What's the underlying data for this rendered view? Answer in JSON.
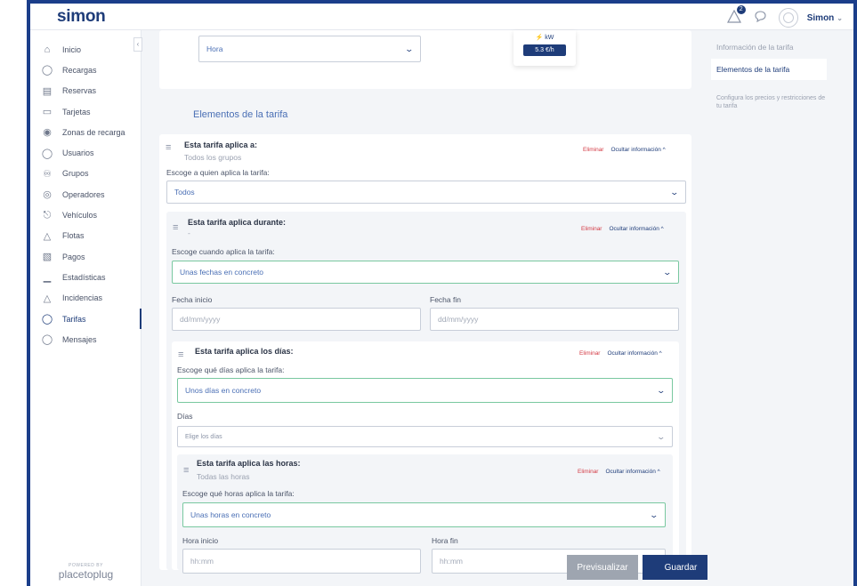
{
  "app": {
    "logo": "simon"
  },
  "topbar": {
    "notifications_count": "2",
    "user_name": "Simon"
  },
  "sidebar": {
    "items": [
      {
        "label": "Inicio",
        "icon": "home-icon"
      },
      {
        "label": "Recargas",
        "icon": "charge-icon"
      },
      {
        "label": "Reservas",
        "icon": "calendar-icon"
      },
      {
        "label": "Tarjetas",
        "icon": "card-icon"
      },
      {
        "label": "Zonas de recarga",
        "icon": "location-icon"
      },
      {
        "label": "Usuarios",
        "icon": "user-icon"
      },
      {
        "label": "Grupos",
        "icon": "group-icon"
      },
      {
        "label": "Operadores",
        "icon": "operator-icon"
      },
      {
        "label": "Vehículos",
        "icon": "car-icon"
      },
      {
        "label": "Flotas",
        "icon": "fleet-icon"
      },
      {
        "label": "Pagos",
        "icon": "payment-icon"
      },
      {
        "label": "Estadísticas",
        "icon": "stats-icon"
      },
      {
        "label": "Incidencias",
        "icon": "alert-icon"
      },
      {
        "label": "Tarifas",
        "icon": "tag-icon",
        "active": true
      },
      {
        "label": "Mensajes",
        "icon": "chat-icon"
      }
    ],
    "powered_by": "POWERED BY",
    "powered_brand": "placetoplug"
  },
  "top_card": {
    "hora_select_value": "Hora",
    "kw_label": "⚡ kW",
    "price": "5.3 €/h"
  },
  "section_title": "Elementos de la tarifa",
  "groups_block": {
    "title": "Esta tarifa aplica a:",
    "subtitle": "Todos los grupos",
    "delete_label": "Eliminar",
    "hide_label": "Ocultar información ^",
    "select_label": "Escoge a quien aplica la tarifa:",
    "select_value": "Todos"
  },
  "dates_block": {
    "title": "Esta tarifa aplica durante:",
    "subtitle": "-",
    "delete_label": "Eliminar",
    "hide_label": "Ocultar información ^",
    "select_label": "Escoge cuando aplica la tarifa:",
    "select_value": "Unas fechas en concreto",
    "start_label": "Fecha inicio",
    "start_placeholder": "dd/mm/yyyy",
    "end_label": "Fecha fin",
    "end_placeholder": "dd/mm/yyyy"
  },
  "days_block": {
    "title": "Esta tarifa aplica los días:",
    "delete_label": "Eliminar",
    "hide_label": "Ocultar información ^",
    "select_label": "Escoge qué días aplica la tarifa:",
    "select_value": "Unos días en concreto",
    "days_label": "Días",
    "days_placeholder": "Elige los días"
  },
  "hours_block": {
    "title": "Esta tarifa aplica las horas:",
    "subtitle": "Todas las horas",
    "delete_label": "Eliminar",
    "hide_label": "Ocultar información ^",
    "select_label": "Escoge qué horas aplica la tarifa:",
    "select_value": "Unas horas en concreto",
    "start_label": "Hora inicio",
    "start_placeholder": "hh:mm",
    "end_label": "Hora fin",
    "end_placeholder": "hh:mm"
  },
  "buttons": {
    "preview": "Previsualizar",
    "save": "Guardar"
  },
  "right_panel": {
    "link": "Información de la tarifa",
    "active": "Elementos de la tarifa",
    "description": "Configura los precios y restricciones de tu tarifa"
  }
}
